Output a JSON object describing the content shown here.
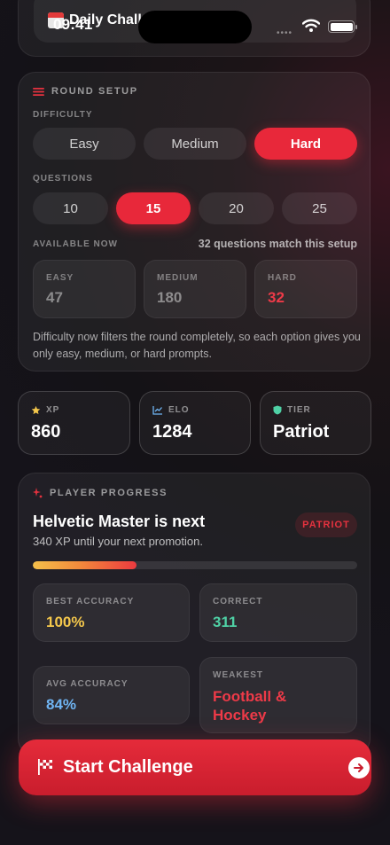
{
  "status_bar": {
    "time": "09:41"
  },
  "header": {
    "title": "Daily Chall"
  },
  "round_setup": {
    "title": "ROUND SETUP",
    "difficulty_label": "DIFFICULTY",
    "difficulty_options": [
      "Easy",
      "Medium",
      "Hard"
    ],
    "difficulty_selected": "Hard",
    "questions_label": "QUESTIONS",
    "question_options": [
      "10",
      "15",
      "20",
      "25"
    ],
    "questions_selected": "15",
    "available_label": "AVAILABLE NOW",
    "match_text": "32 questions match this setup",
    "counts": [
      {
        "label": "EASY",
        "value": "47"
      },
      {
        "label": "MEDIUM",
        "value": "180"
      },
      {
        "label": "HARD",
        "value": "32"
      }
    ],
    "note": "Difficulty now filters the round completely, so each option gives you only easy, medium, or hard prompts."
  },
  "metrics": [
    {
      "label": "XP",
      "value": "860",
      "icon": "star-icon"
    },
    {
      "label": "ELO",
      "value": "1284",
      "icon": "chart-line-icon"
    },
    {
      "label": "TIER",
      "value": "Patriot",
      "icon": "shield-icon"
    }
  ],
  "player_progress": {
    "title": "PLAYER PROGRESS",
    "headline": "Helvetic Master is next",
    "subtitle": "340 XP until your next promotion.",
    "badge": "PATRIOT",
    "progress_fraction": 0.32,
    "stats": [
      {
        "label": "BEST ACCURACY",
        "value": "100%",
        "color": "#f5c84c"
      },
      {
        "label": "CORRECT",
        "value": "311",
        "color": "#4fd1a5"
      },
      {
        "label": "AVG ACCURACY",
        "value": "84%",
        "color": "#6fb4f2"
      },
      {
        "label": "WEAKEST",
        "value": "Football & Hockey",
        "color": "#ee3a48"
      }
    ]
  },
  "cta": {
    "label": "Start Challenge"
  },
  "colors": {
    "accent": "#e8283a",
    "hard_count": "#ee3a48"
  }
}
